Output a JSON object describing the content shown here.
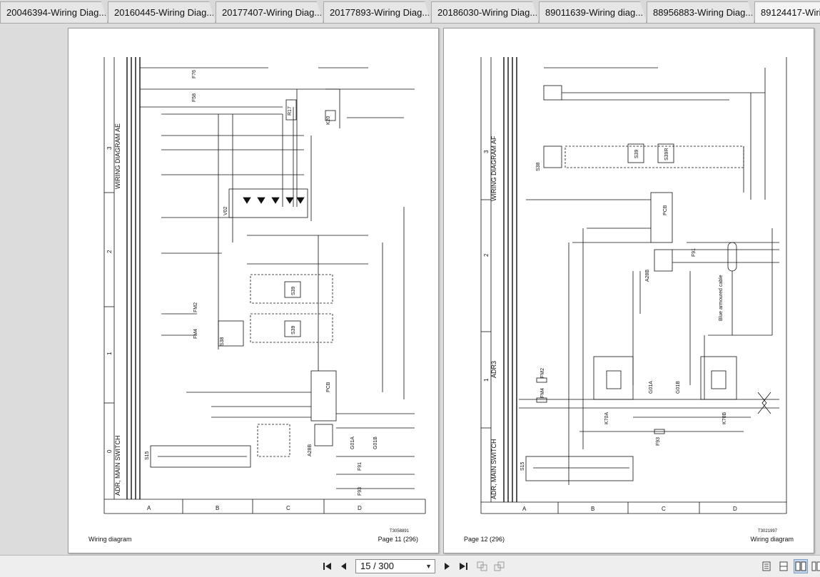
{
  "tabs": [
    {
      "label": "20046394-Wiring Diag..."
    },
    {
      "label": "20160445-Wiring Diag..."
    },
    {
      "label": "20177407-Wiring Diag..."
    },
    {
      "label": "20177893-Wiring Diag..."
    },
    {
      "label": "20186030-Wiring Diag..."
    },
    {
      "label": "89011639-Wiring diag..."
    },
    {
      "label": "88956883-Wiring Diag..."
    },
    {
      "label": "89124417-Wiri"
    }
  ],
  "left_page": {
    "footer_left": "Wiring diagram",
    "footer_right": "Page 11 (296)",
    "doc_id": "T3058891",
    "title_main": "WIRING DIAGRAM AE",
    "title_sub": "ADR, MAIN SWITCH",
    "row_labels": [
      "A",
      "B",
      "C",
      "D"
    ],
    "col_labels": [
      "3",
      "2",
      "1",
      "0"
    ],
    "components": [
      "F76",
      "F58",
      "R17",
      "K20",
      "V02",
      "S39",
      "S39",
      "S38",
      "FM2",
      "FM4",
      "PCB",
      "A28B",
      "G01A",
      "G01B",
      "F91",
      "F93",
      "S15"
    ]
  },
  "right_page": {
    "footer_left": "Page 12 (296)",
    "footer_right": "Wiring diagram",
    "doc_id": "T3021997",
    "title_main": "WIRING DIAGRAM AF",
    "title_adr": "ADR3",
    "title_sub": "ADR, MAIN SWITCH",
    "row_labels": [
      "A",
      "B",
      "C",
      "D"
    ],
    "col_labels": [
      "3",
      "2",
      "1"
    ],
    "cable_label": "Blue armoured cable",
    "components": [
      "S38",
      "S39",
      "S39R",
      "PCB",
      "A28B",
      "F91",
      "FM2",
      "FM4",
      "K70A",
      "G01A",
      "G01B",
      "K70B",
      "F93",
      "S15"
    ]
  },
  "toolbar": {
    "page_value": "15 / 300"
  }
}
